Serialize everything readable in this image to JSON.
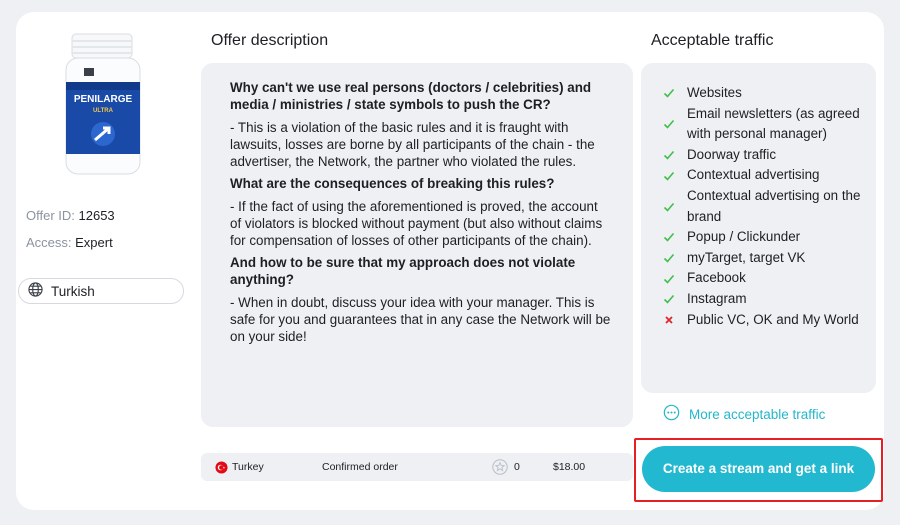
{
  "product": {
    "bottle_brand": "PENILARGE",
    "bottle_sub": "ULTRA"
  },
  "meta": {
    "offer_id_label": "Offer ID:",
    "offer_id_value": "12653",
    "access_label": "Access:",
    "access_value": "Expert"
  },
  "language": {
    "icon": "globe-icon",
    "label": "Turkish"
  },
  "description": {
    "title": "Offer description",
    "blocks": [
      {
        "question": "Why can't we use real persons (doctors / celebrities) and media / ministries / state symbols to push the CR?",
        "answer": "- This is a violation of the basic rules and it is fraught with lawsuits, losses are borne by all participants of the chain - the advertiser, the Network, the partner who violated the rules."
      },
      {
        "question": "What are the consequences of breaking this rules?",
        "answer": "- If the fact of using the aforementioned is proved, the account of violators is blocked without payment (but also without claims for compensation of losses of other participants of the chain)."
      },
      {
        "question": "And how to be sure that my approach does not violate anything?",
        "answer": "- When in doubt, discuss your idea with your manager. This is safe for you and guarantees that in any case the Network will be on your side!"
      }
    ]
  },
  "order": {
    "country": "Turkey",
    "type": "Confirmed order",
    "count": "0",
    "price": "$18.00",
    "colors": {
      "flag": "#e30a17"
    }
  },
  "traffic": {
    "title": "Acceptable traffic",
    "items": [
      {
        "label": "Websites",
        "allowed": true
      },
      {
        "label": "Email newsletters (as agreed with personal manager)",
        "allowed": true
      },
      {
        "label": "Doorway traffic",
        "allowed": true
      },
      {
        "label": "Contextual advertising",
        "allowed": true
      },
      {
        "label": "Contextual advertising on the brand",
        "allowed": true
      },
      {
        "label": "Popup / Clickunder",
        "allowed": true
      },
      {
        "label": "myTarget, target VK",
        "allowed": true
      },
      {
        "label": "Facebook",
        "allowed": true
      },
      {
        "label": "Instagram",
        "allowed": true
      },
      {
        "label": "Public VC, OK and My World",
        "allowed": false
      }
    ],
    "more_label": "More acceptable traffic",
    "colors": {
      "check": "#3fbf4a",
      "cross": "#e0262b",
      "link": "#24b7c9"
    }
  },
  "cta": {
    "label": "Create a stream and get a link",
    "colors": {
      "background": "#22b8cf",
      "outline": "#e51f23"
    }
  }
}
